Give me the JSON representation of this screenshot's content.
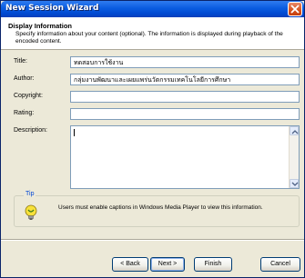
{
  "window": {
    "title": "New Session Wizard"
  },
  "header": {
    "title": "Display Information",
    "description": "Specify information about your content (optional). The information is displayed during playback of the encoded content."
  },
  "fields": {
    "title": {
      "label": "Title:",
      "value": "ทดสอบการใช้งาน"
    },
    "author": {
      "label": "Author:",
      "value": "กลุ่มงานพัฒนาและเผยแพร่นวัตกรรมเทคโนโลยีการศึกษา"
    },
    "copyright": {
      "label": "Copyright:",
      "value": ""
    },
    "rating": {
      "label": "Rating:",
      "value": ""
    },
    "description": {
      "label": "Description:",
      "value": ""
    }
  },
  "tip": {
    "legend": "Tip",
    "text": "Users must enable captions in Windows Media Player to view this information.",
    "icon": "lightbulb-icon"
  },
  "buttons": {
    "back": "< Back",
    "next": "Next >",
    "finish": "Finish",
    "cancel": "Cancel"
  },
  "colors": {
    "titlebar": "#0a5ce0",
    "close": "#d6501c",
    "tip_legend": "#0046d5"
  }
}
